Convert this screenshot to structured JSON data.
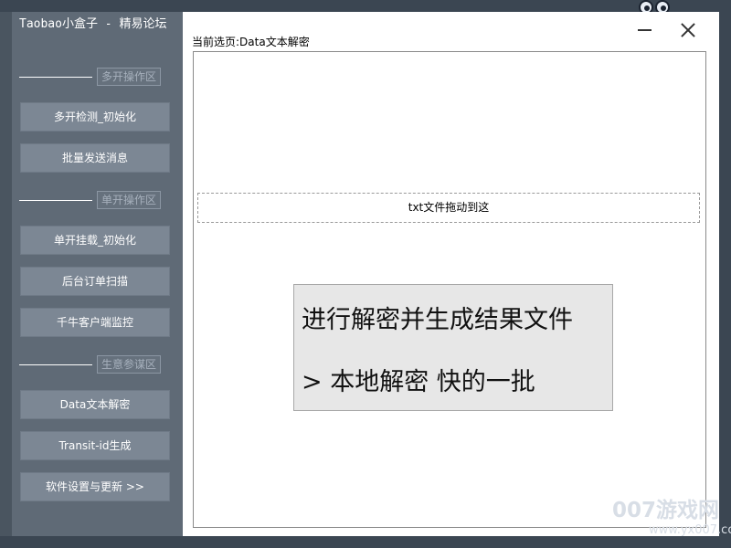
{
  "app": {
    "title": "Taobao小盒子 - 精易论坛"
  },
  "sidebar": {
    "sections": [
      {
        "label": "多开操作区"
      },
      {
        "label": "单开操作区"
      },
      {
        "label": "生意参谋区"
      }
    ],
    "buttons": [
      {
        "label": "多开检测_初始化"
      },
      {
        "label": "批量发送消息"
      },
      {
        "label": "单开挂载_初始化"
      },
      {
        "label": "后台订单扫描"
      },
      {
        "label": "千牛客户端监控"
      },
      {
        "label": "Data文本解密"
      },
      {
        "label": "Transit-id生成"
      },
      {
        "label": "软件设置与更新 >>"
      }
    ]
  },
  "main": {
    "current_page": "当前选页:Data文本解密",
    "drop_zone": "txt文件拖动到这",
    "actions": [
      {
        "label": "进行解密并生成结果文件"
      },
      {
        "label": "> 本地解密 快的一批"
      }
    ]
  },
  "watermark": {
    "big": "007游戏网",
    "small": "www.yx007.com"
  }
}
